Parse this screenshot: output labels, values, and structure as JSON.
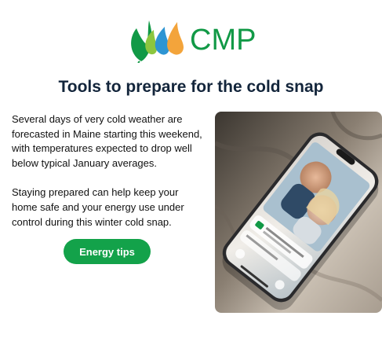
{
  "brand": {
    "name": "CMP",
    "color_green": "#119946",
    "color_light_green": "#8cc63f",
    "color_blue": "#2e95d3",
    "color_orange": "#f3a43b"
  },
  "headline": "Tools to prepare for the cold snap",
  "paragraphs": [
    "Several days of very cold weather are forecasted in Maine starting this weekend, with temperatures expected to drop well below typical January averages.",
    "Staying prepared can help keep your home safe and your energy use under control during this winter cold snap."
  ],
  "cta": {
    "label": "Energy tips",
    "color": "#13a24a"
  },
  "image": {
    "subject": "smartphone-on-table"
  }
}
